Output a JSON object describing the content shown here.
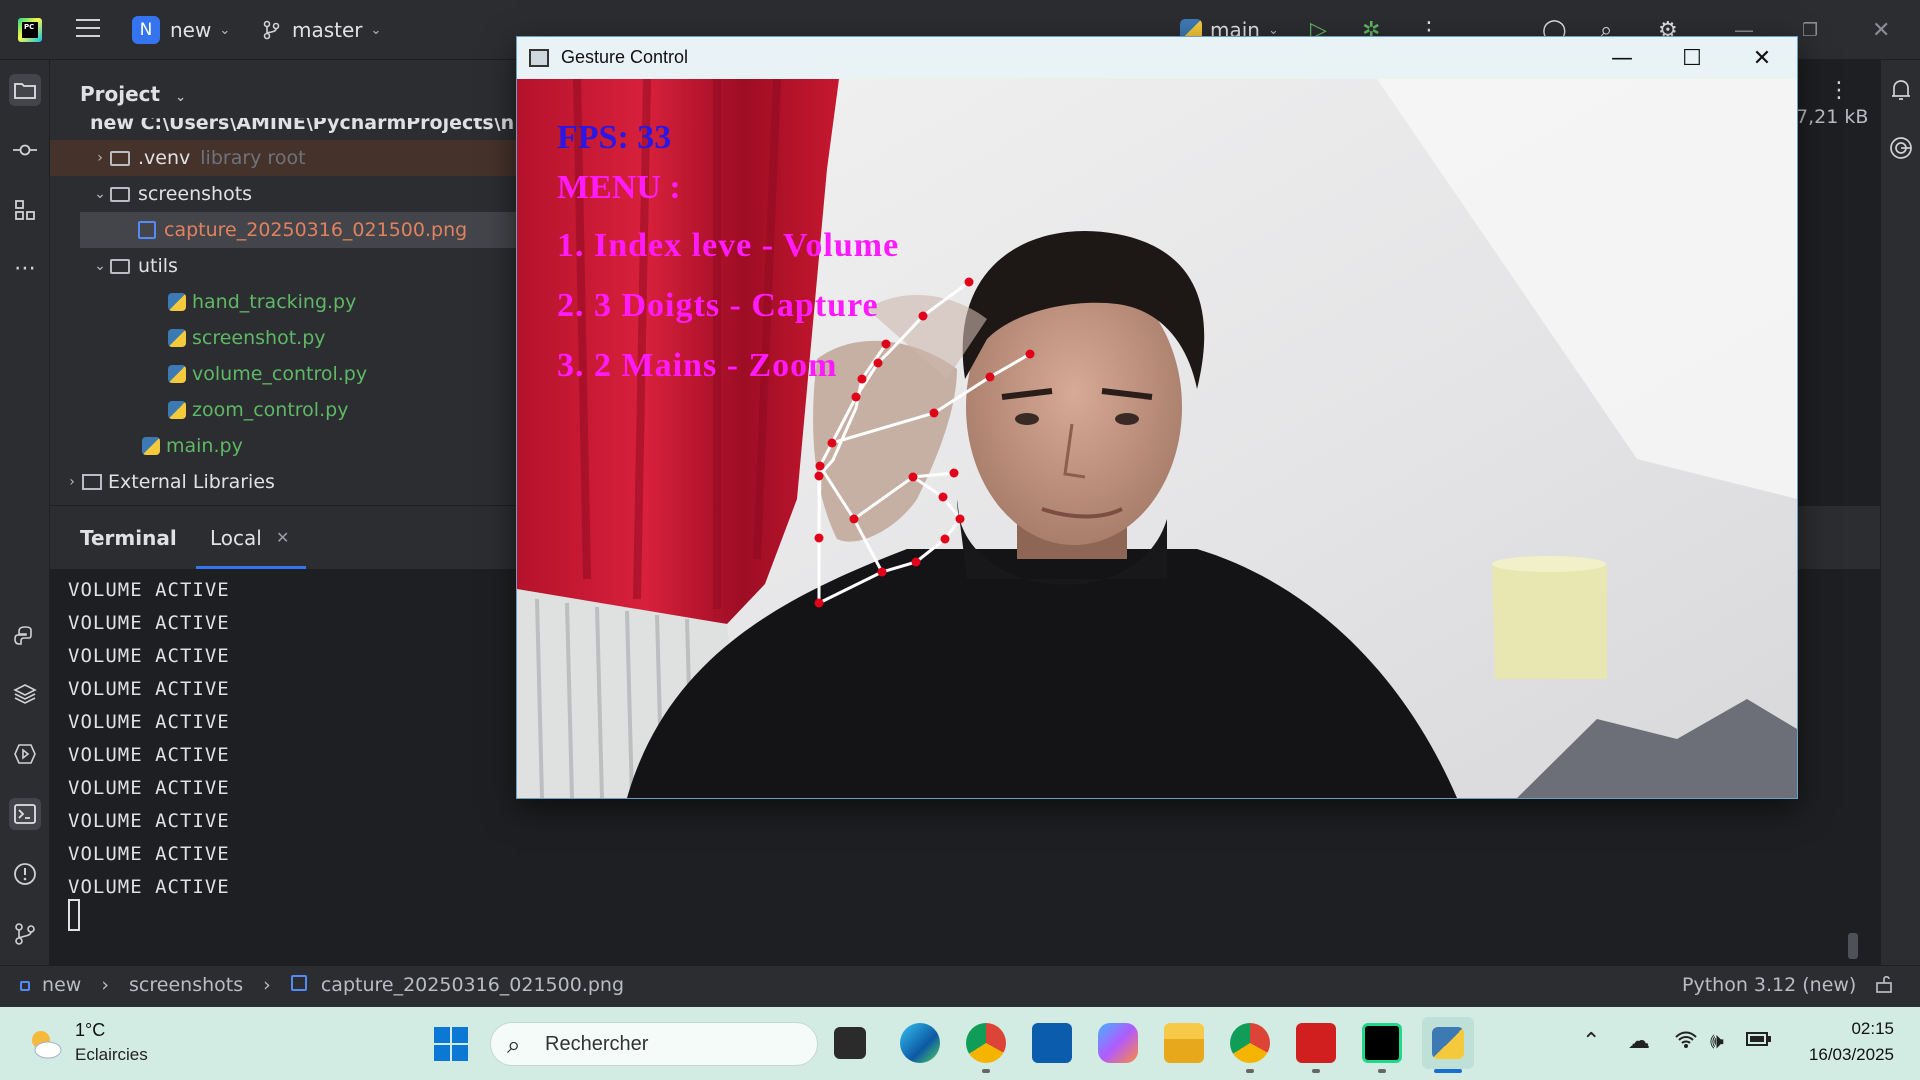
{
  "toolbar": {
    "project_initial": "N",
    "project_name": "new",
    "branch": "master",
    "run_config": "main"
  },
  "project_panel": {
    "header": "Project",
    "root_partial": "new  C:\\Users\\AMINE\\PycharmProjects\\n",
    "venv": ".venv",
    "venv_note": "library root",
    "screenshots": "screenshots",
    "capture_file": "capture_20250316_021500.png",
    "utils": "utils",
    "files": [
      "hand_tracking.py",
      "screenshot.py",
      "volume_control.py",
      "zoom_control.py"
    ],
    "main": "main.py",
    "external": "External Libraries"
  },
  "editor": {
    "file_size": "7,21 kB"
  },
  "terminal": {
    "title": "Terminal",
    "tab": "Local",
    "lines": [
      "VOLUME ACTIVE",
      "VOLUME ACTIVE",
      "VOLUME ACTIVE",
      "VOLUME ACTIVE",
      "VOLUME ACTIVE",
      "VOLUME ACTIVE",
      "VOLUME ACTIVE",
      "VOLUME ACTIVE",
      "VOLUME ACTIVE",
      "VOLUME ACTIVE"
    ]
  },
  "statusbar": {
    "crumb1": "new",
    "crumb2": "screenshots",
    "crumb3": "capture_20250316_021500.png",
    "interpreter": "Python 3.12 (new)"
  },
  "gesture_window": {
    "title": "Gesture Control",
    "fps": "FPS: 33",
    "menu": "MENU :",
    "item1": "1. Index leve - Volume",
    "item2": "2. 3 Doigts - Capture",
    "item3": "3. 2 Mains - Zoom",
    "fps_color": "#2a16e6",
    "menu_color": "#ff1aff"
  },
  "taskbar": {
    "temp": "1°C",
    "weather": "Eclaircies",
    "search_placeholder": "Rechercher",
    "time": "02:15",
    "date": "16/03/2025"
  },
  "colors": {
    "ide_bg": "#1e1f22",
    "panel_bg": "#2b2d30",
    "accent": "#3574f0",
    "file_green": "#5fb865",
    "file_orange": "#e0825f"
  }
}
